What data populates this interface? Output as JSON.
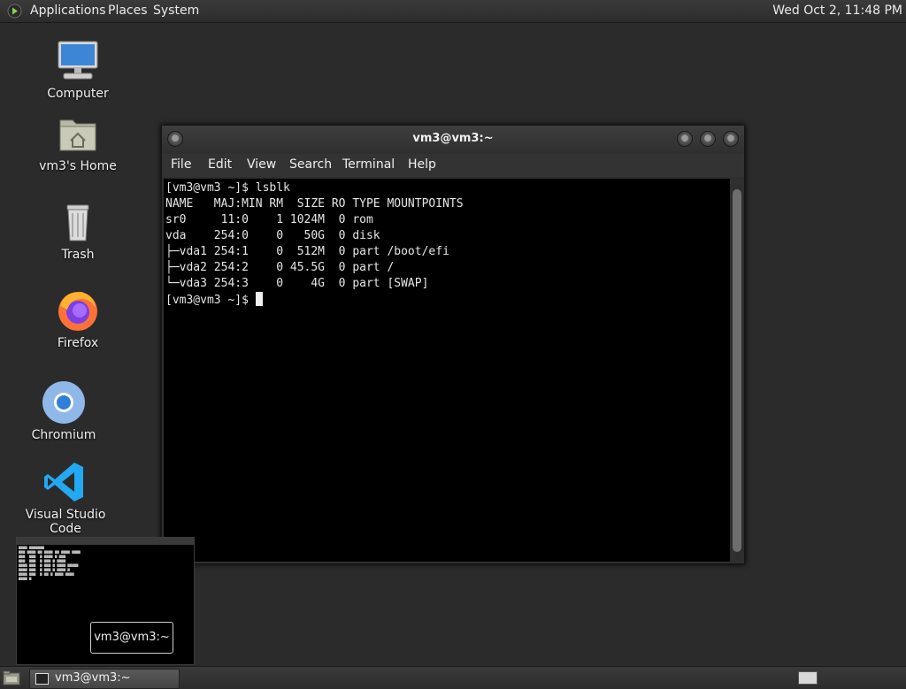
{
  "top_panel": {
    "menus": [
      "Applications",
      "Places",
      "System"
    ],
    "clock": "Wed Oct  2, 11:48 PM"
  },
  "desktop": {
    "icons": [
      {
        "label": "Computer",
        "icon": "computer-icon"
      },
      {
        "label": "vm3's Home",
        "icon": "home-folder-icon"
      },
      {
        "label": "Trash",
        "icon": "trash-icon"
      },
      {
        "label": "Firefox",
        "icon": "firefox-icon"
      },
      {
        "label": "Chromium",
        "icon": "chromium-icon"
      },
      {
        "label": "Visual Studio Code",
        "icon": "vscode-icon"
      }
    ]
  },
  "terminal": {
    "title": "vm3@vm3:~",
    "menu": [
      "File",
      "Edit",
      "View",
      "Search",
      "Terminal",
      "Help"
    ],
    "lines": [
      "[vm3@vm3 ~]$ lsblk",
      "NAME   MAJ:MIN RM  SIZE RO TYPE MOUNTPOINTS",
      "sr0     11:0    1 1024M  0 rom",
      "vda    254:0    0   50G  0 disk",
      "├─vda1 254:1    0  512M  0 part /boot/efi",
      "├─vda2 254:2    0 45.5G  0 part /",
      "└─vda3 254:3    0    4G  0 part [SWAP]"
    ],
    "prompt": "[vm3@vm3 ~]$ "
  },
  "preview": {
    "label": "vm3@vm3:~"
  },
  "taskbar": {
    "task_label": "vm3@vm3:~"
  },
  "colors": {
    "desktop_bg": "#2b2b2b",
    "terminal_bg": "#000000",
    "firefox_orange": "#ff7139",
    "chromium_blue": "#4a90e2",
    "vscode_blue": "#23a9f2"
  }
}
